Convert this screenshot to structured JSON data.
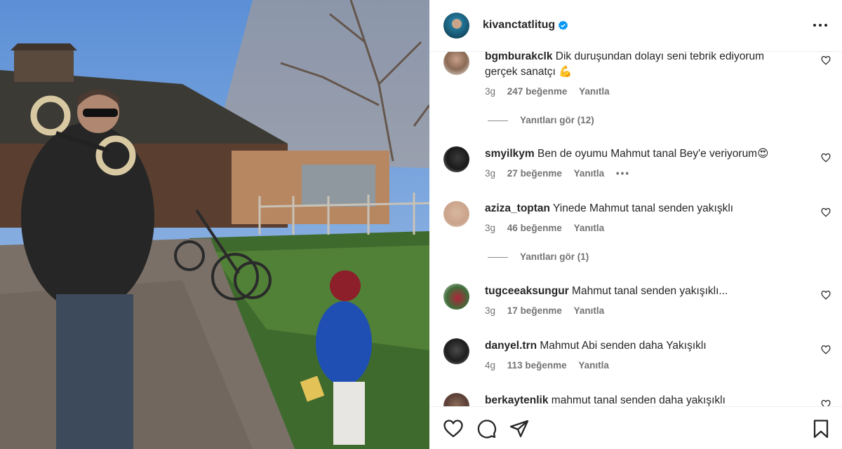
{
  "post": {
    "username": "kivanctatlitug",
    "verified_icon": "verified-badge-icon",
    "more_icon": "more-options-icon",
    "accent_color": "#0095f6"
  },
  "comments": [
    {
      "user": "bgmburakclk",
      "text": "Dik duruşundan dolayı seni tebrik ediyorum gerçek sanatçı 💪",
      "age": "3g",
      "likes": "247 beğenme",
      "reply": "Yanıtla",
      "view_replies": "Yanıtları gör (12)"
    },
    {
      "user": "smyilkym",
      "text": "Ben de oyumu Mahmut tanal Bey'e veriyorum😍",
      "age": "3g",
      "likes": "27 beğenme",
      "reply": "Yanıtla",
      "extra": "•••"
    },
    {
      "user": "aziza_toptan",
      "text": "Yinede Mahmut tanal senden yakışklı",
      "age": "3g",
      "likes": "46 beğenme",
      "reply": "Yanıtla",
      "view_replies": "Yanıtları gör (1)"
    },
    {
      "user": "tugceeaksungur",
      "text": "Mahmut tanal senden yakışıklı...",
      "age": "3g",
      "likes": "17 beğenme",
      "reply": "Yanıtla"
    },
    {
      "user": "danyel.trn",
      "text": "Mahmut Abi senden daha Yakışıklı",
      "age": "4g",
      "likes": "113 beğenme",
      "reply": "Yanıtla"
    },
    {
      "user": "berkaytenlik",
      "text": "mahmut tanal senden daha yakışıklı"
    }
  ],
  "actions": {
    "like_icon": "heart-icon",
    "comment_icon": "comment-icon",
    "share_icon": "share-icon",
    "save_icon": "bookmark-icon"
  }
}
